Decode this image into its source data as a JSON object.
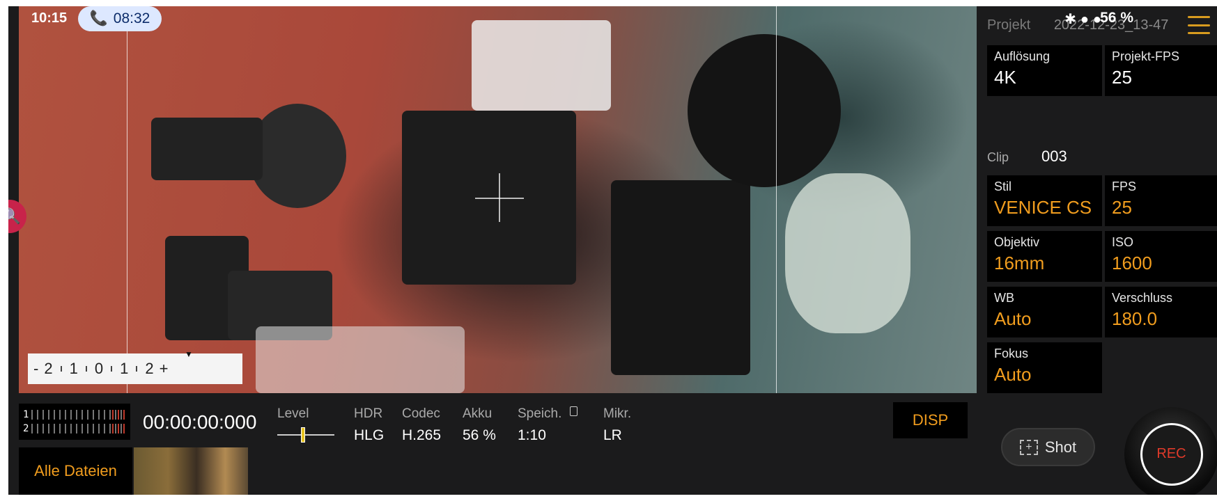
{
  "status_bar": {
    "time": "10:15",
    "call_timer": "08:32",
    "battery": "56 %"
  },
  "viewfinder": {
    "focus_scale": [
      "-",
      "2",
      "1",
      "0",
      "1",
      "2",
      "+"
    ]
  },
  "panel": {
    "project_label": "Projekt",
    "project_value": "2022-12-23_13-47",
    "resolution_label": "Auflösung",
    "resolution_value": "4K",
    "project_fps_label": "Projekt-FPS",
    "project_fps_value": "25",
    "clip_label": "Clip",
    "clip_value": "003",
    "style_label": "Stil",
    "style_value": "VENICE CS",
    "fps_label": "FPS",
    "fps_value": "25",
    "lens_label": "Objektiv",
    "lens_value": "16mm",
    "iso_label": "ISO",
    "iso_value": "1600",
    "wb_label": "WB",
    "wb_value": "Auto",
    "shutter_label": "Verschluss",
    "shutter_value": "180.0",
    "focus_label": "Fokus",
    "focus_value": "Auto",
    "shot_label": "Shot",
    "rec_label": "REC"
  },
  "bottom": {
    "meter_ch1": "1",
    "meter_ch2": "2",
    "timecode": "00:00:00:000",
    "level_label": "Level",
    "level_fraction": 0.45,
    "hdr_label": "HDR",
    "hdr_value": "HLG",
    "codec_label": "Codec",
    "codec_value": "H.265",
    "battery_label": "Akku",
    "battery_value": "56 %",
    "storage_label": "Speich.",
    "storage_value": "1:10",
    "mic_label": "Mikr.",
    "mic_value": "LR",
    "disp_label": "DISP",
    "all_files_label": "Alle Dateien"
  },
  "colors": {
    "accent": "#f19d1e",
    "rec": "#e03a2a",
    "menu": "#d99c1f"
  }
}
